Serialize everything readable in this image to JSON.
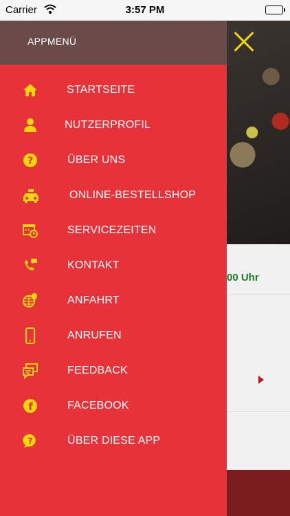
{
  "status_bar": {
    "carrier": "Carrier",
    "time": "3:57 PM"
  },
  "drawer": {
    "title": "APPMENÜ",
    "items": [
      {
        "label": "STARTSEITE",
        "icon": "home-icon"
      },
      {
        "label": "NUTZERPROFIL",
        "icon": "user-icon"
      },
      {
        "label": "ÜBER UNS",
        "icon": "question-icon"
      },
      {
        "label": "ONLINE-BESTELLSHOP",
        "icon": "taxi-icon"
      },
      {
        "label": "SERVICEZEITEN",
        "icon": "calendar-clock-icon"
      },
      {
        "label": "KONTAKT",
        "icon": "phone-chat-icon"
      },
      {
        "label": "ANFAHRT",
        "icon": "globe-pin-icon"
      },
      {
        "label": "ANRUFEN",
        "icon": "mobile-phone-icon"
      },
      {
        "label": "FEEDBACK",
        "icon": "chat-bubbles-icon"
      },
      {
        "label": "FACEBOOK",
        "icon": "facebook-icon"
      },
      {
        "label": "ÜBER DIESE APP",
        "icon": "question-bubble-icon"
      }
    ]
  },
  "background": {
    "hours_text": "00 Uhr"
  },
  "colors": {
    "drawer": "#e8323a",
    "header": "#6a4b4a",
    "icon": "#f4d70b",
    "close": "#f4d70b"
  }
}
